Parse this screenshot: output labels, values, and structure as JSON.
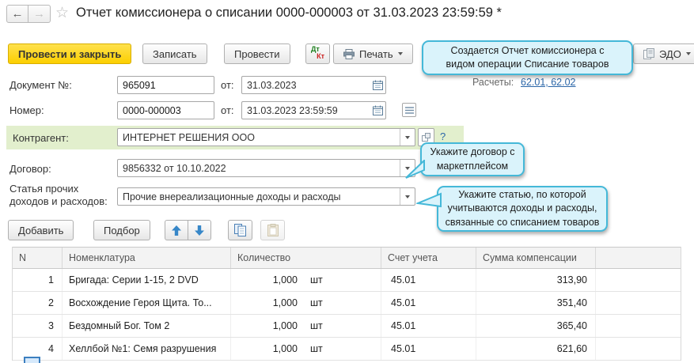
{
  "window": {
    "title": "Отчет комиссионера о списании 0000-000003 от 31.03.2023 23:59:59 *"
  },
  "icons": {
    "back_glyph": "←",
    "forward_glyph": "→",
    "star_glyph": "☆"
  },
  "toolbar": {
    "post_close": "Провести и закрыть",
    "save": "Записать",
    "post": "Провести",
    "dtkt": {
      "dt": "Дт",
      "kt": "Кт"
    },
    "print": "Печать",
    "edo": "ЭДО"
  },
  "tooltips": {
    "operation": "Создается Отчет комиссионера  с\nвидом операции Списание товаров",
    "contract": "Укажите договор с\nмаркетплейсом",
    "article": "Укажите статью, по которой\nучитываются доходы и расходы,\nсвязанные со списанием товаров"
  },
  "form": {
    "doc_number": {
      "label": "Документ №:",
      "value": "965091",
      "from_label": "от:",
      "date": "31.03.2023"
    },
    "number": {
      "label": "Номер:",
      "value": "0000-000003",
      "from_label": "от:",
      "datetime": "31.03.2023 23:59:59"
    },
    "settlements": {
      "label": "Расчеты:",
      "links": "62.01, 62.02"
    },
    "counterparty": {
      "label": "Контрагент:",
      "value": "ИНТЕРНЕТ РЕШЕНИЯ ООО",
      "help": "?"
    },
    "contract": {
      "label": "Договор:",
      "value": "9856332 от 10.10.2022"
    },
    "article": {
      "label_line1": "Статья прочих",
      "label_line2": "доходов и расходов:",
      "value": "Прочие внереализационные доходы и расходы"
    }
  },
  "commands": {
    "add": "Добавить",
    "pick": "Подбор"
  },
  "table": {
    "headers": [
      "N",
      "Номенклатура",
      "Количество",
      "Счет учета",
      "Сумма компенсации"
    ],
    "rows": [
      {
        "n": "1",
        "item": "Бригада: Серии 1-15, 2 DVD",
        "qty": "1,000",
        "unit": "шт",
        "account": "45.01",
        "sum": "313,90"
      },
      {
        "n": "2",
        "item": "Восхождение Героя Щита. То...",
        "qty": "1,000",
        "unit": "шт",
        "account": "45.01",
        "sum": "351,40"
      },
      {
        "n": "3",
        "item": "Бездомный Бог. Том 2",
        "qty": "1,000",
        "unit": "шт",
        "account": "45.01",
        "sum": "365,40"
      },
      {
        "n": "4",
        "item": "Хеллбой №1: Семя разрушения",
        "qty": "1,000",
        "unit": "шт",
        "account": "45.01",
        "sum": "621,60"
      }
    ]
  },
  "colors": {
    "accent_yellow": "#fccf00",
    "tooltip_bg": "#daf3fb",
    "tooltip_border": "#44b8d8",
    "row_highlight": "#e2efcd",
    "link_blue": "#2b66a8"
  }
}
